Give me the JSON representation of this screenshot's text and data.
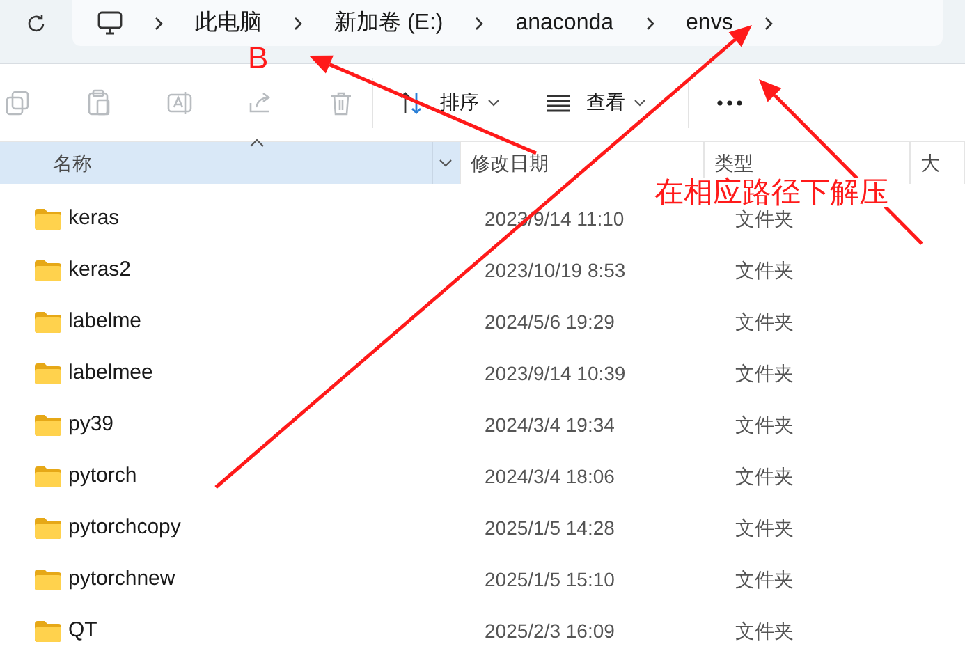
{
  "address_bar": {
    "crumbs": [
      "此电脑",
      "新加卷 (E:)",
      "anaconda",
      "envs"
    ]
  },
  "toolbar": {
    "actions": [
      {
        "kind": "copy",
        "disabled": true
      },
      {
        "kind": "paste",
        "disabled": true
      },
      {
        "kind": "rename",
        "disabled": true
      },
      {
        "kind": "share",
        "disabled": true
      },
      {
        "kind": "delete",
        "disabled": true
      }
    ],
    "menus": [
      {
        "kind": "sort",
        "label": "排序"
      },
      {
        "kind": "view",
        "label": "查看"
      }
    ]
  },
  "table": {
    "columns": [
      {
        "label": "名称",
        "selected": true
      },
      {
        "label": "修改日期",
        "selected": false
      },
      {
        "label": "类型",
        "selected": false
      },
      {
        "label": "大",
        "selected": false
      }
    ],
    "rows": [
      {
        "name": "keras",
        "modified": "2023/9/14 11:10",
        "type": "文件夹"
      },
      {
        "name": "keras2",
        "modified": "2023/10/19 8:53",
        "type": "文件夹"
      },
      {
        "name": "labelme",
        "modified": "2024/5/6 19:29",
        "type": "文件夹"
      },
      {
        "name": "labelmee",
        "modified": "2023/9/14 10:39",
        "type": "文件夹"
      },
      {
        "name": "py39",
        "modified": "2024/3/4 19:34",
        "type": "文件夹"
      },
      {
        "name": "pytorch",
        "modified": "2024/3/4 18:06",
        "type": "文件夹"
      },
      {
        "name": "pytorchcopy",
        "modified": "2025/1/5 14:28",
        "type": "文件夹"
      },
      {
        "name": "pytorchnew",
        "modified": "2025/1/5 15:10",
        "type": "文件夹"
      },
      {
        "name": "QT",
        "modified": "2025/2/3 16:09",
        "type": "文件夹"
      }
    ]
  },
  "annotations": [
    {
      "kind": "label",
      "text": "B"
    },
    {
      "kind": "label",
      "text": "在相应路径下解压"
    },
    {
      "kind": "arrow"
    },
    {
      "kind": "arrow"
    },
    {
      "kind": "arrow"
    }
  ]
}
